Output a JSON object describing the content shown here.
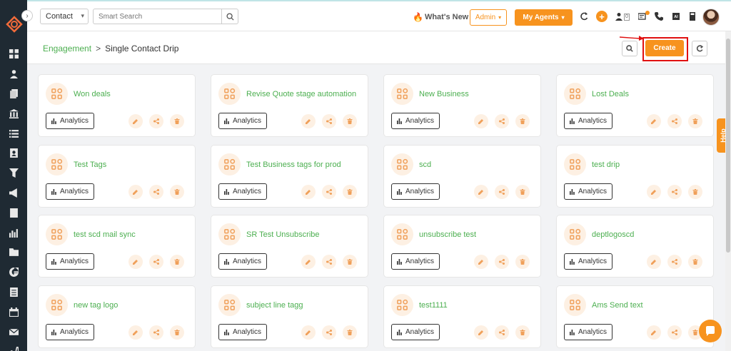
{
  "topbar": {
    "module_select": "Contact",
    "search_placeholder": "Smart Search",
    "whats_new": "What's New",
    "admin_label": "Admin",
    "my_agents_label": "My Agents",
    "notification_count": "0"
  },
  "subheader": {
    "breadcrumb_parent": "Engagement",
    "breadcrumb_separator": ">",
    "breadcrumb_current": "Single Contact Drip",
    "create_label": "Create"
  },
  "cards": [
    {
      "title": "Won deals",
      "analytics": "Analytics"
    },
    {
      "title": "Revise Quote stage automation",
      "analytics": "Analytics"
    },
    {
      "title": "New Business",
      "analytics": "Analytics"
    },
    {
      "title": "Lost Deals",
      "analytics": "Analytics"
    },
    {
      "title": "Test Tags",
      "analytics": "Analytics"
    },
    {
      "title": "Test Business tags for prod",
      "analytics": "Analytics"
    },
    {
      "title": "scd",
      "analytics": "Analytics"
    },
    {
      "title": "test drip",
      "analytics": "Analytics"
    },
    {
      "title": "test scd mail sync",
      "analytics": "Analytics"
    },
    {
      "title": "SR Test Unsubscribe",
      "analytics": "Analytics"
    },
    {
      "title": "unsubscribe test",
      "analytics": "Analytics"
    },
    {
      "title": "deptlogoscd",
      "analytics": "Analytics"
    },
    {
      "title": "new tag logo",
      "analytics": "Analytics"
    },
    {
      "title": "subject line tagg",
      "analytics": "Analytics"
    },
    {
      "title": "test1111",
      "analytics": "Analytics"
    },
    {
      "title": "Ams Send text",
      "analytics": "Analytics"
    }
  ],
  "help_label": "Help",
  "colors": {
    "accent": "#f7931e",
    "title_green": "#4caf50",
    "sidebar": "#1f2a33"
  }
}
